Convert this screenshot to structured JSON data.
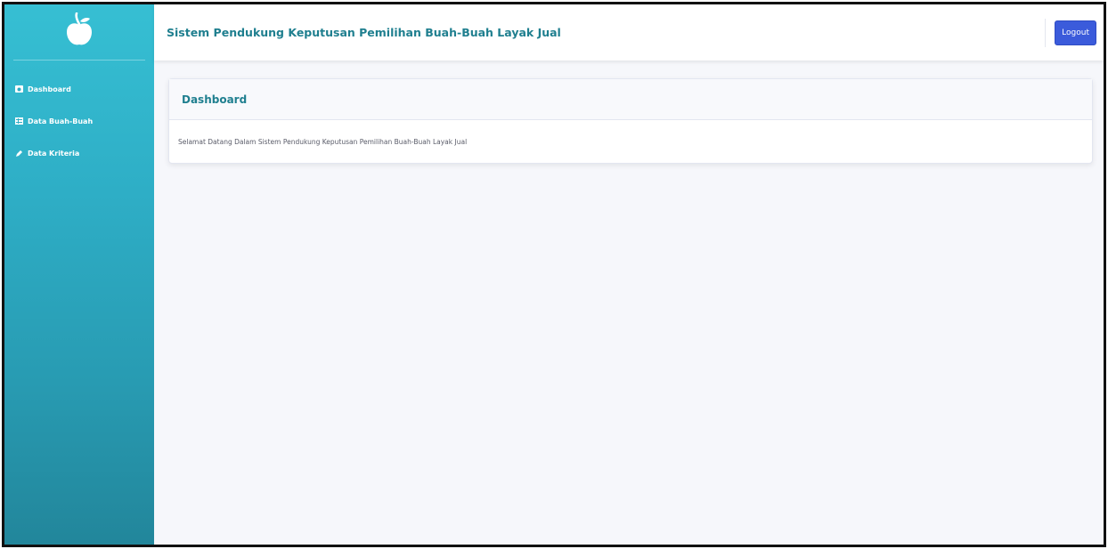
{
  "sidebar": {
    "logo_icon": "apple-icon",
    "items": [
      {
        "label": "Dashboard",
        "icon": "tachometer-icon"
      },
      {
        "label": "Data Buah-Buah",
        "icon": "table-icon"
      },
      {
        "label": "Data Kriteria",
        "icon": "pencil-icon"
      }
    ]
  },
  "header": {
    "title": "Sistem Pendukung Keputusan Pemilihan Buah-Buah Layak Jual",
    "logout_label": "Logout"
  },
  "card": {
    "title": "Dashboard",
    "message": "Selamat Datang Dalam Sistem Pendukung Keputusan Pemilihan Buah-Buah Layak Jual"
  },
  "colors": {
    "sidebar_top": "#36bfd3",
    "sidebar_bottom": "#22869b",
    "title_teal": "#1f7f8f",
    "logout_blue": "#3b5bdb",
    "page_bg": "#f6f7fb"
  }
}
